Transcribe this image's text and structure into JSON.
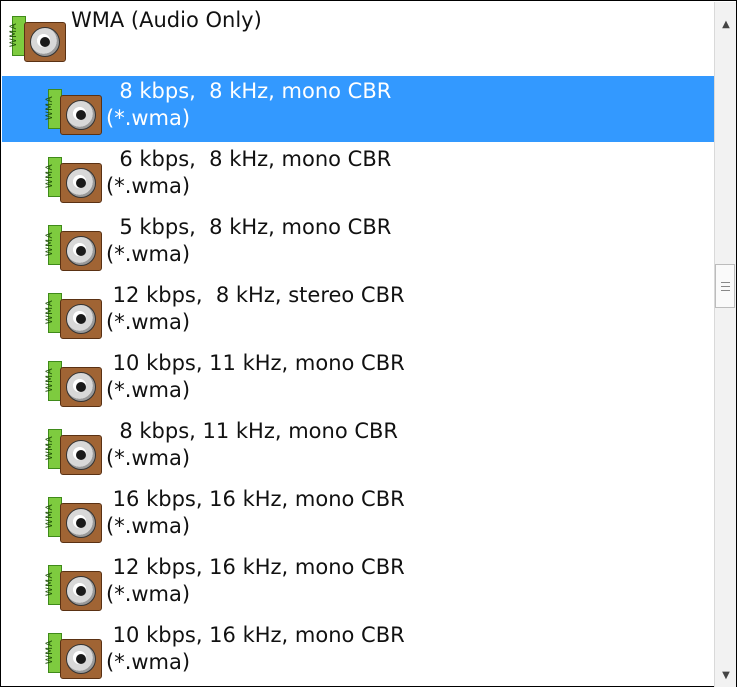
{
  "group": {
    "label": "WMA (Audio Only)",
    "icon": "wma-speaker-icon",
    "icon_badge": "WMA"
  },
  "items": [
    {
      "line1": "  8 kbps,  8 kHz, mono CBR",
      "line2": "(*.wma)",
      "selected": true
    },
    {
      "line1": "  6 kbps,  8 kHz, mono CBR",
      "line2": "(*.wma)",
      "selected": false
    },
    {
      "line1": "  5 kbps,  8 kHz, mono CBR",
      "line2": "(*.wma)",
      "selected": false
    },
    {
      "line1": " 12 kbps,  8 kHz, stereo CBR",
      "line2": "(*.wma)",
      "selected": false
    },
    {
      "line1": " 10 kbps, 11 kHz, mono CBR",
      "line2": "(*.wma)",
      "selected": false
    },
    {
      "line1": "  8 kbps, 11 kHz, mono CBR",
      "line2": "(*.wma)",
      "selected": false
    },
    {
      "line1": " 16 kbps, 16 kHz, mono CBR",
      "line2": "(*.wma)",
      "selected": false
    },
    {
      "line1": " 12 kbps, 16 kHz, mono CBR",
      "line2": "(*.wma)",
      "selected": false
    },
    {
      "line1": " 10 kbps, 16 kHz, mono CBR",
      "line2": "(*.wma)",
      "selected": false
    }
  ],
  "colors": {
    "selection": "#3399ff",
    "selected_text": "#ffffff",
    "text": "#111111"
  },
  "scrollbar": {
    "up_icon": "chevron-up-icon",
    "down_icon": "chevron-down-icon",
    "up_glyph": "▲",
    "down_glyph": "▼"
  }
}
